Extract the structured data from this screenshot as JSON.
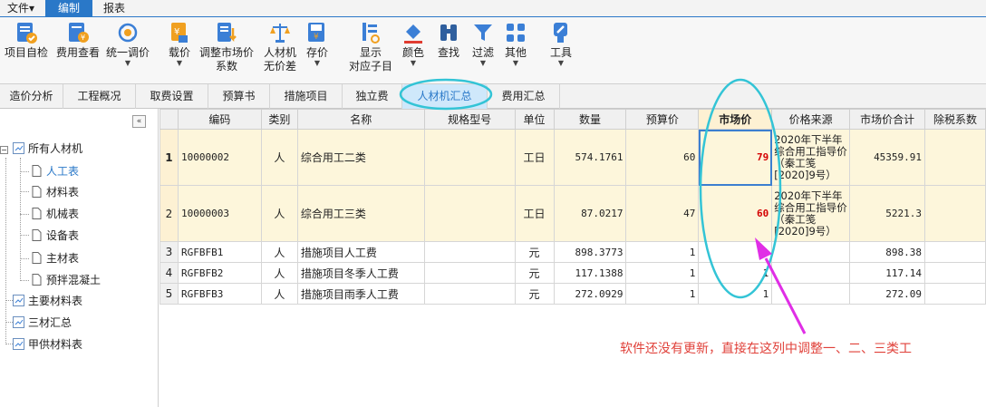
{
  "menu": {
    "items": [
      "文件▾",
      "编制",
      "报表"
    ],
    "active_index": 1
  },
  "toolbar": {
    "items": [
      {
        "label1": "项目自检",
        "label2": "",
        "icon": "checklist-icon",
        "caret": false
      },
      {
        "label1": "费用查看",
        "label2": "",
        "icon": "money-view-icon",
        "caret": false
      },
      {
        "label1": "统一调价",
        "label2": "",
        "icon": "unify-price-icon",
        "caret": true
      },
      {
        "label1": "载价",
        "label2": "",
        "icon": "load-price-icon",
        "caret": true
      },
      {
        "label1": "调整市场价",
        "label2": "系数",
        "icon": "adjust-coefficient-icon",
        "caret": false
      },
      {
        "label1": "人材机",
        "label2": "无价差",
        "icon": "scale-icon",
        "caret": false
      },
      {
        "label1": "存价",
        "label2": "",
        "icon": "save-price-icon",
        "caret": true
      },
      {
        "label1": "显示",
        "label2": "对应子目",
        "icon": "show-subitem-icon",
        "caret": false
      },
      {
        "label1": "颜色",
        "label2": "",
        "icon": "paint-bucket-icon",
        "caret": true
      },
      {
        "label1": "查找",
        "label2": "",
        "icon": "binoculars-icon",
        "caret": false
      },
      {
        "label1": "过滤",
        "label2": "",
        "icon": "filter-icon",
        "caret": true
      },
      {
        "label1": "其他",
        "label2": "",
        "icon": "grid-more-icon",
        "caret": true
      },
      {
        "label1": "工具",
        "label2": "",
        "icon": "tools-icon",
        "caret": true
      }
    ]
  },
  "tabs": {
    "items": [
      "造价分析",
      "工程概况",
      "取费设置",
      "预算书",
      "措施项目",
      "独立费",
      "人材机汇总",
      "费用汇总"
    ],
    "active_index": 6
  },
  "tree": {
    "collapse_label": "«",
    "root": "所有人材机",
    "children": [
      "人工表",
      "材料表",
      "机械表",
      "设备表",
      "主材表",
      "预拌混凝土"
    ],
    "selected_child": 0,
    "siblings": [
      "主要材料表",
      "三材汇总",
      "甲供材料表"
    ]
  },
  "table": {
    "columns": [
      "",
      "编码",
      "类别",
      "名称",
      "规格型号",
      "单位",
      "数量",
      "预算价",
      "市场价",
      "价格来源",
      "市场价合计",
      "除税系数"
    ],
    "rows": [
      {
        "no": "1",
        "code": "10000002",
        "type": "人",
        "name": "综合用工二类",
        "spec": "",
        "unit": "工日",
        "qty": "574.1761",
        "budget": "60",
        "market": "79",
        "source": "2020年下半年综合用工指导价（秦工笺[2020]9号）",
        "total": "45359.91",
        "tax": ""
      },
      {
        "no": "2",
        "code": "10000003",
        "type": "人",
        "name": "综合用工三类",
        "spec": "",
        "unit": "工日",
        "qty": "87.0217",
        "budget": "47",
        "market": "60",
        "source": "2020年下半年综合用工指导价（秦工笺[2020]9号）",
        "total": "5221.3",
        "tax": ""
      },
      {
        "no": "3",
        "code": "RGFBFB1",
        "type": "人",
        "name": "措施项目人工费",
        "spec": "",
        "unit": "元",
        "qty": "898.3773",
        "budget": "1",
        "market": "1",
        "source": "",
        "total": "898.38",
        "tax": ""
      },
      {
        "no": "4",
        "code": "RGFBFB2",
        "type": "人",
        "name": "措施项目冬季人工费",
        "spec": "",
        "unit": "元",
        "qty": "117.1388",
        "budget": "1",
        "market": "1",
        "source": "",
        "total": "117.14",
        "tax": ""
      },
      {
        "no": "5",
        "code": "RGFBFB3",
        "type": "人",
        "name": "措施项目雨季人工费",
        "spec": "",
        "unit": "元",
        "qty": "272.0929",
        "budget": "1",
        "market": "1",
        "source": "",
        "total": "272.09",
        "tax": ""
      }
    ]
  },
  "annotation": {
    "text": "软件还没有更新，直接在这列中调整一、二、三类工",
    "color": "#e0413a",
    "circle_color": "#33c4d6",
    "arrow_color": "#e02ee6"
  },
  "colors": {
    "accent": "#2a78c8",
    "highlight_row": "#fdf6db",
    "market_value": "#d40000"
  }
}
